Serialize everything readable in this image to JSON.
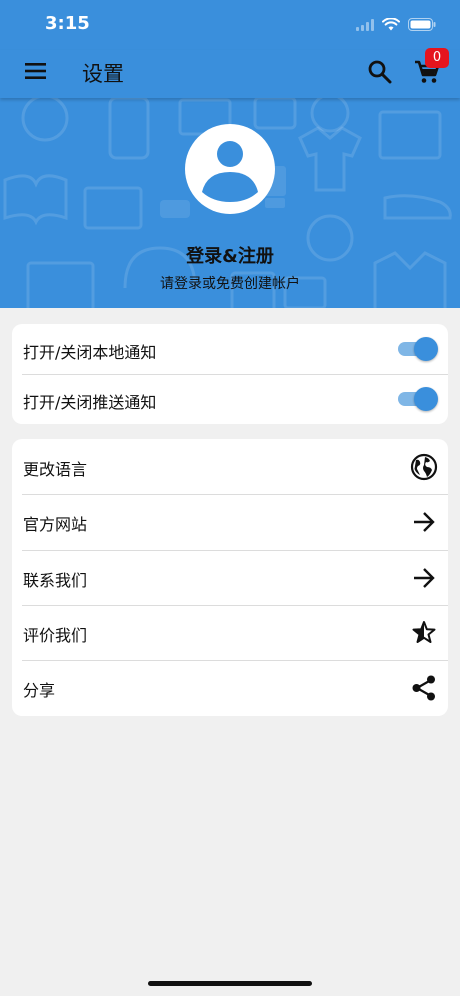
{
  "status_bar": {
    "time": "3:15"
  },
  "appbar": {
    "title": "设置",
    "cart_count": "0"
  },
  "header": {
    "login_title": "登录&注册",
    "login_subtitle": "请登录或免费创建帐户"
  },
  "notifications": [
    {
      "label": "打开/关闭本地通知",
      "enabled": true
    },
    {
      "label": "打开/关闭推送通知",
      "enabled": true
    }
  ],
  "menu": [
    {
      "label": "更改语言",
      "icon": "globe-icon"
    },
    {
      "label": "官方网站",
      "icon": "arrow-right-icon"
    },
    {
      "label": "联系我们",
      "icon": "arrow-right-icon"
    },
    {
      "label": "评价我们",
      "icon": "star-half-icon"
    },
    {
      "label": "分享",
      "icon": "share-icon"
    }
  ],
  "colors": {
    "primary": "#3a8fdc",
    "toggle_track": "#7fb6e6",
    "badge": "#e5141e",
    "background": "#f0f0f0"
  }
}
